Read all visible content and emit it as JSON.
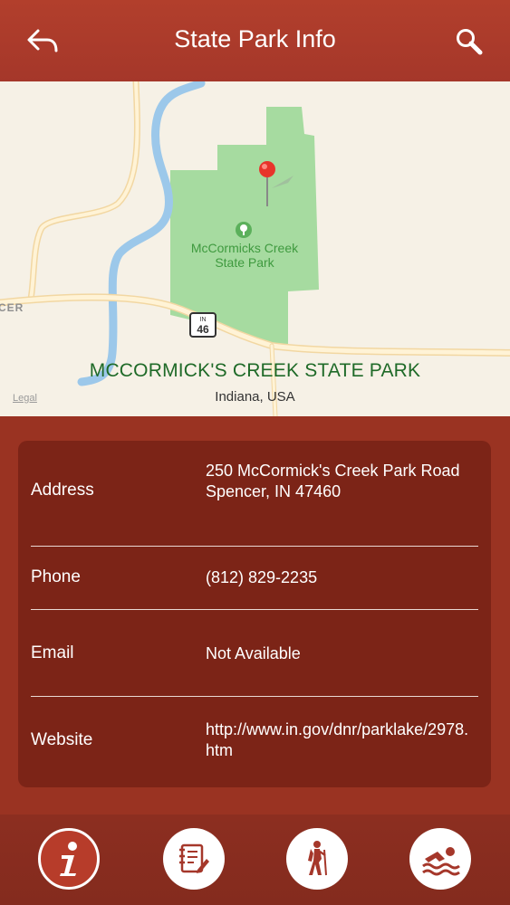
{
  "header": {
    "title": "State Park Info",
    "back_icon": "back-arrow-icon",
    "search_icon": "search-icon"
  },
  "map": {
    "park_title": "MCCORMICK'S CREEK STATE PARK",
    "location": "Indiana, USA",
    "legal": "Legal",
    "park_label": "McCormicks Creek State Park",
    "town_label": "CER",
    "highway_label": "IN",
    "highway_number": "46"
  },
  "info": {
    "rows": [
      {
        "label": "Address",
        "value_lines": [
          "250 McCormick's Creek Park Road",
          "Spencer, IN 47460"
        ]
      },
      {
        "label": "Phone",
        "value": "(812) 829-2235"
      },
      {
        "label": "Email",
        "value": "Not Available"
      },
      {
        "label": "Website",
        "value": "http://www.in.gov/dnr/parklake/2978.htm"
      }
    ]
  },
  "tabs": [
    {
      "name": "info",
      "icon": "info-icon",
      "active": true
    },
    {
      "name": "notes",
      "icon": "notepad-icon",
      "active": false
    },
    {
      "name": "hiking",
      "icon": "hiker-icon",
      "active": false
    },
    {
      "name": "swimming",
      "icon": "swimmer-icon",
      "active": false
    }
  ],
  "colors": {
    "header": "#b23f2c",
    "background": "#9a3322",
    "park_title": "#1f6a28",
    "park_fill": "#a6dba0"
  }
}
